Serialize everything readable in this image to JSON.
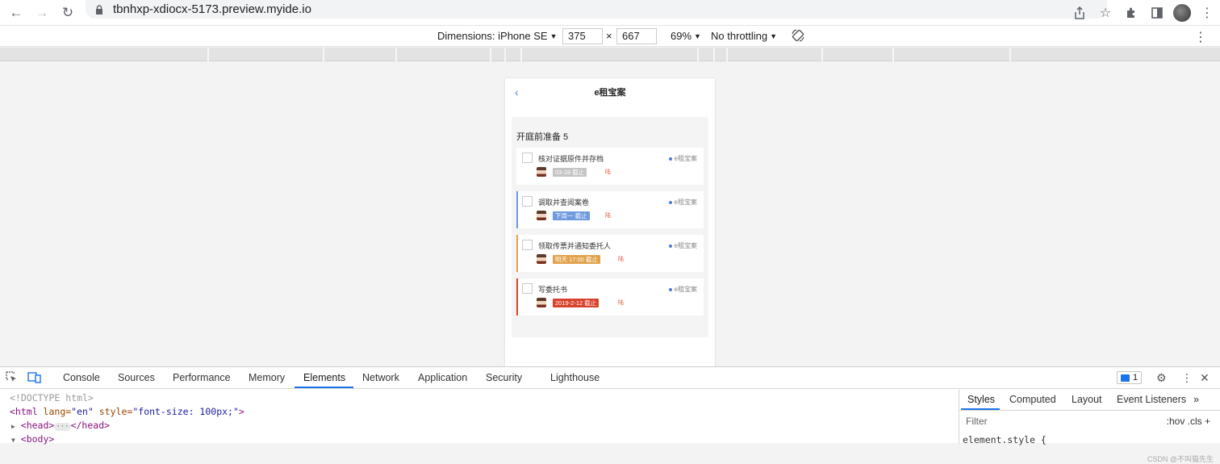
{
  "browser": {
    "url": "tbnhxp-xdiocx-5173.preview.myide.io",
    "icons": [
      "back-icon",
      "forward-icon",
      "reload-icon",
      "lock-icon",
      "share-icon",
      "star-icon",
      "extensions-icon",
      "sidepanel-icon",
      "profile-avatar",
      "menu-icon"
    ]
  },
  "device_toolbar": {
    "dimensions_label": "Dimensions: iPhone SE",
    "width": "375",
    "times": "×",
    "height": "667",
    "zoom": "69%",
    "throttling": "No throttling"
  },
  "app": {
    "title": "e租宝案",
    "group": {
      "title": "开庭前准备 5"
    },
    "tasks": [
      {
        "title": "调取并查阅案卷",
        "source": "e租宝案",
        "deadline": "下周一 截止",
        "color": "#6f9ae0"
      },
      {
        "title": "领取传票并通知委托人",
        "source": "e租宝案",
        "deadline": "明天 17:00 截止",
        "color": "#e0a24a"
      },
      {
        "title": "写委托书",
        "source": "e租宝案",
        "deadline": "2019-2-12 截止",
        "color": "#d9432e"
      },
      {
        "title": "核对证据原件并存档",
        "source": "e租宝案",
        "deadline": "03-28 截止",
        "color": "#c4c4c4"
      }
    ],
    "sub_mark": "陆"
  },
  "devtools": {
    "tabs": [
      "Console",
      "Sources",
      "Performance",
      "Memory",
      "Elements",
      "Network",
      "Application",
      "Security",
      "Lighthouse"
    ],
    "active_tab": "Elements",
    "issues_count": "1",
    "dom_lines": {
      "doctype": "<!DOCTYPE html>",
      "html_open_tag": "<html",
      "html_lang_attr": " lang=",
      "html_lang_val": "\"en\"",
      "html_style_attr": " style=",
      "html_style_val": "\"font-size: 100px;\"",
      "html_close": ">",
      "head": "<head>",
      "ellipsis": "···",
      "head_close": "</head>",
      "body": "<body>"
    },
    "styles_tabs": [
      "Styles",
      "Computed",
      "Layout",
      "Event Listeners"
    ],
    "more_tabs": "»",
    "filter_placeholder": "Filter",
    "filter_right": ":hov .cls +",
    "element_style": "element.style {",
    "watermark": "CSDN @不叫猫先生"
  }
}
